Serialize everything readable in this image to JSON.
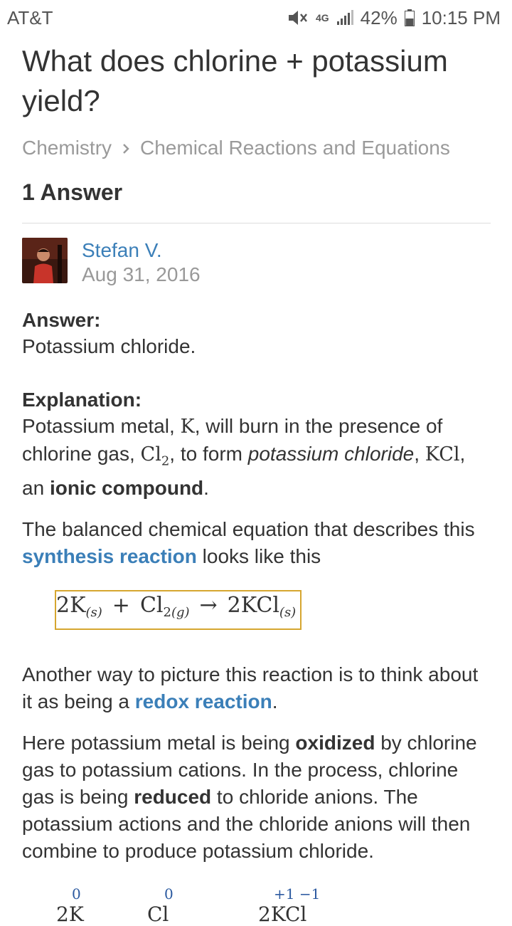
{
  "status": {
    "carrier": "AT&T",
    "network": "4G",
    "battery": "42%",
    "time": "10:15 PM"
  },
  "question": {
    "title": "What does chlorine + potassium yield?"
  },
  "breadcrumb": {
    "subject": "Chemistry",
    "topic": "Chemical Reactions and Equations"
  },
  "answers_count": "1 Answer",
  "author": {
    "name": "Stefan V.",
    "date": "Aug 31, 2016"
  },
  "answer": {
    "heading": "Answer:",
    "text": "Potassium chloride."
  },
  "explanation": {
    "heading": "Explanation:",
    "p1_a": "Potassium metal, ",
    "p1_k": "K",
    "p1_b": ", will burn in the presence of chlorine gas, ",
    "p1_cl": "Cl",
    "p1_cl_sub": "2",
    "p1_c": ", to form ",
    "p1_kcl_italic": "potassium chloride",
    "p1_d": ", ",
    "p1_kcl": "KCl",
    "p1_e": ", an ",
    "p1_bold": "ionic compound",
    "p1_f": ".",
    "p2_a": "The balanced chemical equation that describes this ",
    "p2_link": "synthesis reaction",
    "p2_b": " looks like this",
    "equation": {
      "r1": "2K",
      "r1_state": "(s)",
      "plus": "+",
      "r2": "Cl",
      "r2_sub": "2",
      "r2_state": "(g)",
      "arrow": "→",
      "p1": "2KCl",
      "p1_state": "(s)"
    },
    "p3_a": "Another way to picture this reaction is to think about it as being a ",
    "p3_link": "redox reaction",
    "p3_b": ".",
    "p4_a": "Here potassium metal is being ",
    "p4_bold1": "oxidized",
    "p4_b": " by chlorine gas to potassium cations. In the process, chlorine gas is being ",
    "p4_bold2": "reduced",
    "p4_c": " to chloride anions. The potassium actions and the chloride anions will then combine to produce potassium chloride.",
    "ox_states": {
      "k": "0",
      "cl": "0",
      "kcl": "+1 −1"
    }
  }
}
